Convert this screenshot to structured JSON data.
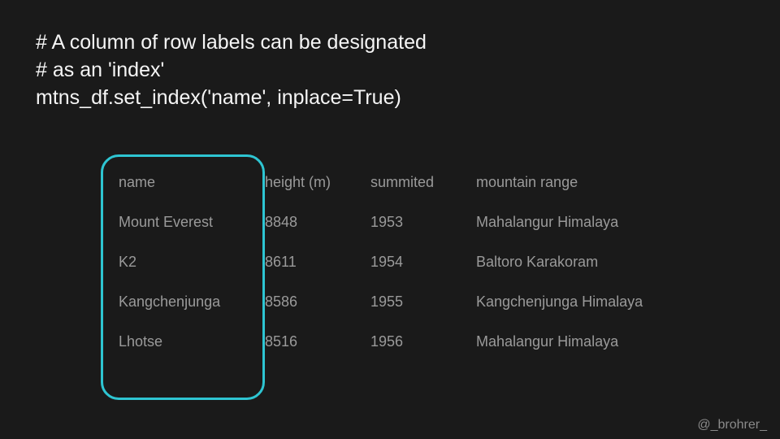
{
  "code": {
    "line1": "# A column of row labels can be designated",
    "line2": "# as an 'index'",
    "line3": "mtns_df.set_index('name', inplace=True)"
  },
  "table": {
    "headers": {
      "name": "name",
      "height": "height (m)",
      "summited": "summited",
      "range": "mountain range"
    },
    "rows": [
      {
        "name": "Mount Everest",
        "height": "8848",
        "summited": "1953",
        "range": "Mahalangur Himalaya"
      },
      {
        "name": "K2",
        "height": "8611",
        "summited": "1954",
        "range": "Baltoro Karakoram"
      },
      {
        "name": "Kangchenjunga",
        "height": "8586",
        "summited": "1955",
        "range": "Kangchenjunga Himalaya"
      },
      {
        "name": "Lhotse",
        "height": "8516",
        "summited": "1956",
        "range": "Mahalangur Himalaya"
      }
    ]
  },
  "credit": "@_brohrer_",
  "highlight_color": "#2ec5d2"
}
